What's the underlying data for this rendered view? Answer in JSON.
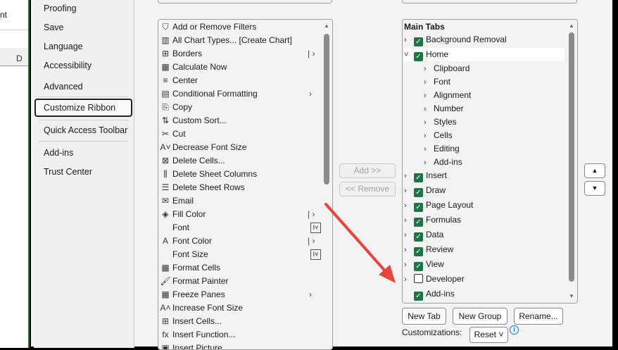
{
  "sheet": {
    "partial_text": "nt",
    "column": "D"
  },
  "nav": {
    "items": [
      "Proofing",
      "Save",
      "Language",
      "Accessibility",
      "Advanced",
      "Customize Ribbon",
      "Quick Access Toolbar",
      "Add-ins",
      "Trust Center"
    ],
    "selected": "Customize Ribbon"
  },
  "commands": [
    {
      "label": "Add or Remove Filters",
      "icon": "⛉"
    },
    {
      "label": "All Chart Types... [Create Chart]",
      "icon": "▥"
    },
    {
      "label": "Borders",
      "icon": "⊞",
      "split": true
    },
    {
      "label": "Calculate Now",
      "icon": "▦"
    },
    {
      "label": "Center",
      "icon": "≡"
    },
    {
      "label": "Conditional Formatting",
      "icon": "▤",
      "submenu": true
    },
    {
      "label": "Copy",
      "icon": "⎘"
    },
    {
      "label": "Custom Sort...",
      "icon": "⇅"
    },
    {
      "label": "Cut",
      "icon": "✂"
    },
    {
      "label": "Decrease Font Size",
      "icon": "A˅"
    },
    {
      "label": "Delete Cells...",
      "icon": "⊠"
    },
    {
      "label": "Delete Sheet Columns",
      "icon": "⫼"
    },
    {
      "label": "Delete Sheet Rows",
      "icon": "☰"
    },
    {
      "label": "Email",
      "icon": "✉"
    },
    {
      "label": "Fill Color",
      "icon": "◈",
      "split": true
    },
    {
      "label": "Font",
      "icon": "",
      "combo": true
    },
    {
      "label": "Font Color",
      "icon": "A",
      "split": true
    },
    {
      "label": "Font Size",
      "icon": "",
      "combo": true
    },
    {
      "label": "Format Cells",
      "icon": "▦"
    },
    {
      "label": "Format Painter",
      "icon": "🖌"
    },
    {
      "label": "Freeze Panes",
      "icon": "▦",
      "submenu": true
    },
    {
      "label": "Increase Font Size",
      "icon": "A˄"
    },
    {
      "label": "Insert Cells...",
      "icon": "⊞"
    },
    {
      "label": "Insert Function...",
      "icon": "fx"
    },
    {
      "label": "Insert Picture",
      "icon": "▣"
    }
  ],
  "middle": {
    "add": "Add >>",
    "remove": "<< Remove"
  },
  "tree": {
    "header": "Main Tabs",
    "nodes": [
      {
        "label": "Background Removal",
        "level": 0,
        "checked": true,
        "chev": "›"
      },
      {
        "label": "Home",
        "level": 0,
        "checked": true,
        "chev": "˅",
        "selected": true
      },
      {
        "label": "Clipboard",
        "level": 1
      },
      {
        "label": "Font",
        "level": 1
      },
      {
        "label": "Alignment",
        "level": 1
      },
      {
        "label": "Number",
        "level": 1
      },
      {
        "label": "Styles",
        "level": 1
      },
      {
        "label": "Cells",
        "level": 1
      },
      {
        "label": "Editing",
        "level": 1
      },
      {
        "label": "Add-ins",
        "level": 1
      },
      {
        "label": "Insert",
        "level": 0,
        "checked": true,
        "chev": "›"
      },
      {
        "label": "Draw",
        "level": 0,
        "checked": true,
        "chev": "›"
      },
      {
        "label": "Page Layout",
        "level": 0,
        "checked": true,
        "chev": "›"
      },
      {
        "label": "Formulas",
        "level": 0,
        "checked": true,
        "chev": "›"
      },
      {
        "label": "Data",
        "level": 0,
        "checked": true,
        "chev": "›"
      },
      {
        "label": "Review",
        "level": 0,
        "checked": true,
        "chev": "›"
      },
      {
        "label": "View",
        "level": 0,
        "checked": true,
        "chev": "›"
      },
      {
        "label": "Developer",
        "level": 0,
        "checked": false,
        "chev": "›"
      },
      {
        "label": "Add-ins",
        "level": 0,
        "checked": true,
        "chev": ""
      }
    ]
  },
  "buttons": {
    "new_tab": "New Tab",
    "new_group": "New Group",
    "rename": "Rename...",
    "customizations": "Customizations:",
    "reset": "Reset ˅"
  },
  "colors": {
    "check": "#217346",
    "arrow": "#e8453c"
  }
}
